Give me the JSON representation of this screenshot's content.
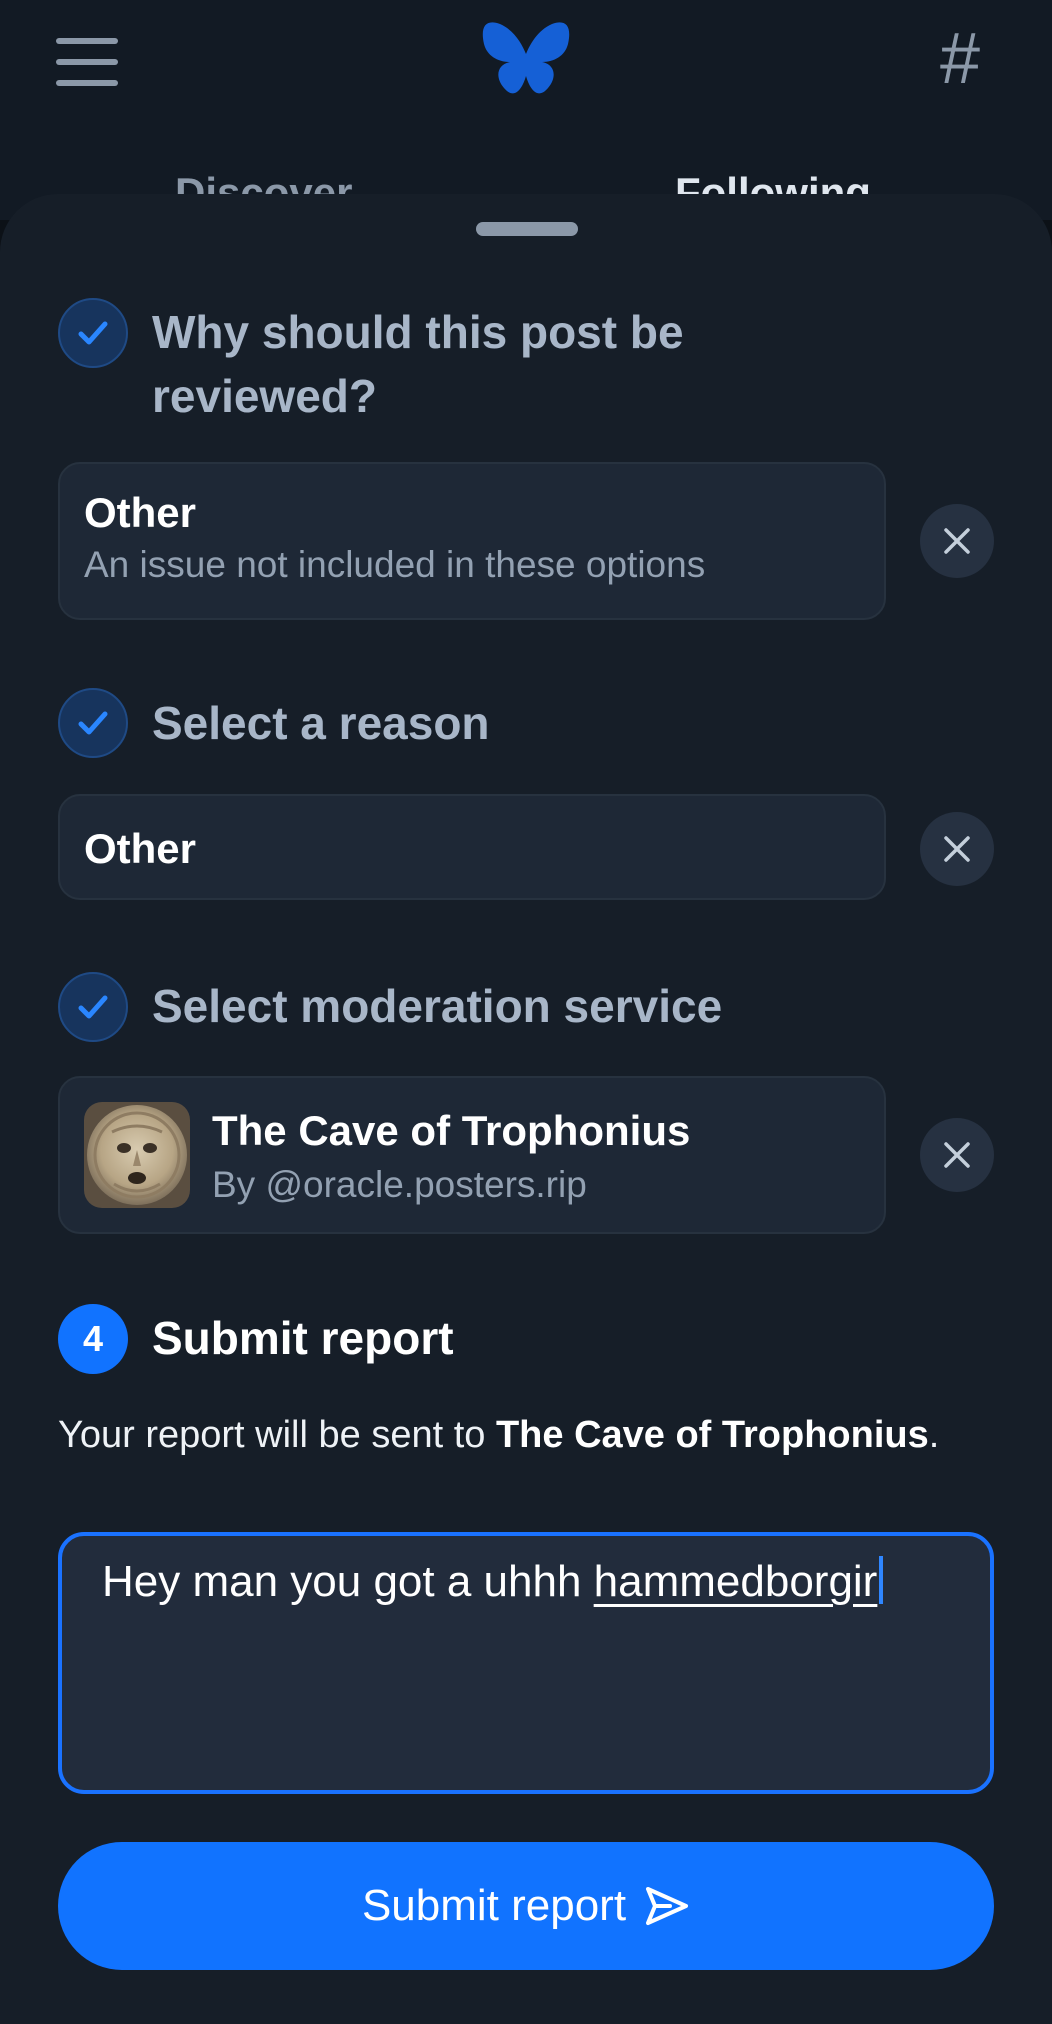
{
  "header": {
    "tabs": [
      "Discover",
      "Following"
    ]
  },
  "steps": [
    {
      "title": "Why should this post be reviewed?",
      "selection": {
        "title": "Other",
        "description": "An issue not included in these options"
      }
    },
    {
      "title": "Select a reason",
      "selection": {
        "title": "Other"
      }
    },
    {
      "title": "Select moderation service",
      "selection": {
        "title": "The Cave of Trophonius",
        "description": "By @oracle.posters.rip"
      }
    },
    {
      "number": "4",
      "title": "Submit report"
    }
  ],
  "report": {
    "note_prefix": "Your report will be sent to ",
    "note_service": "The Cave of Trophonius",
    "note_suffix": ".",
    "text_before": "Hey man you got a uhhh ",
    "text_word": "hammedborgir"
  },
  "submit_label": "Submit report",
  "colors": {
    "accent": "#1173ff",
    "sheet": "#161e28",
    "card": "#1e2836"
  },
  "icons": [
    "menu-icon",
    "butterfly-logo-icon",
    "hashtag-icon",
    "check-icon",
    "close-icon",
    "send-icon"
  ]
}
